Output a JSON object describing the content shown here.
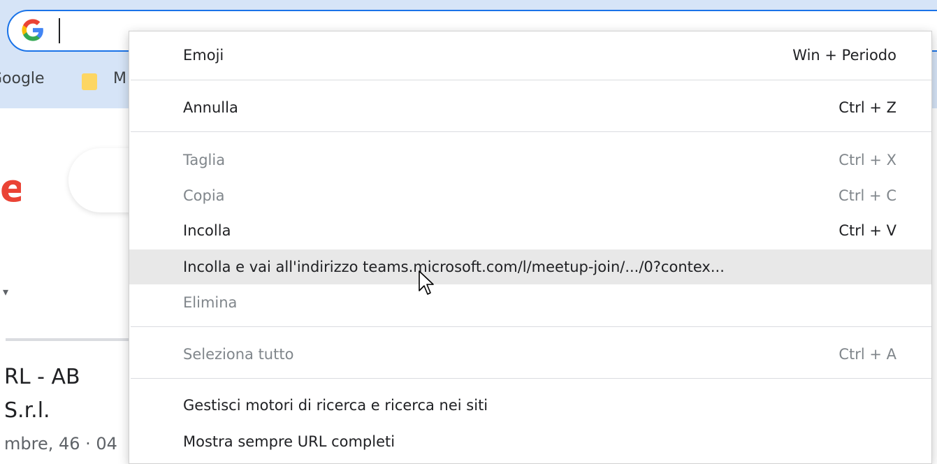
{
  "browser": {
    "bookmarks": {
      "google_label": "Google",
      "folder_label": "M"
    }
  },
  "page": {
    "partial_letter": "e",
    "tick": "▾",
    "result_line_1": "RL - AB",
    "result_line_2": "S.r.l.",
    "result_line_3": "mbre, 46 · 04"
  },
  "context_menu": {
    "items": [
      {
        "label": "Emoji",
        "shortcut": "Win + Periodo",
        "enabled": true
      },
      {
        "label": "Annulla",
        "shortcut": "Ctrl + Z",
        "enabled": true
      },
      {
        "label": "Taglia",
        "shortcut": "Ctrl + X",
        "enabled": false
      },
      {
        "label": "Copia",
        "shortcut": "Ctrl + C",
        "enabled": false
      },
      {
        "label": "Incolla",
        "shortcut": "Ctrl + V",
        "enabled": true
      },
      {
        "label": "Incolla e vai all'indirizzo teams.microsoft.com/l/meetup-join/.../0?contex...",
        "shortcut": "",
        "enabled": true,
        "highlighted": true
      },
      {
        "label": "Elimina",
        "shortcut": "",
        "enabled": false
      },
      {
        "label": "Seleziona tutto",
        "shortcut": "Ctrl + A",
        "enabled": false
      },
      {
        "label": "Gestisci motori di ricerca e ricerca nei siti",
        "shortcut": "",
        "enabled": true
      },
      {
        "label": "Mostra sempre URL completi",
        "shortcut": "",
        "enabled": true
      }
    ]
  },
  "colors": {
    "accent": "#1a73e8",
    "chrome_bg": "#d6e4f7",
    "highlight": "#e8e8e8"
  }
}
